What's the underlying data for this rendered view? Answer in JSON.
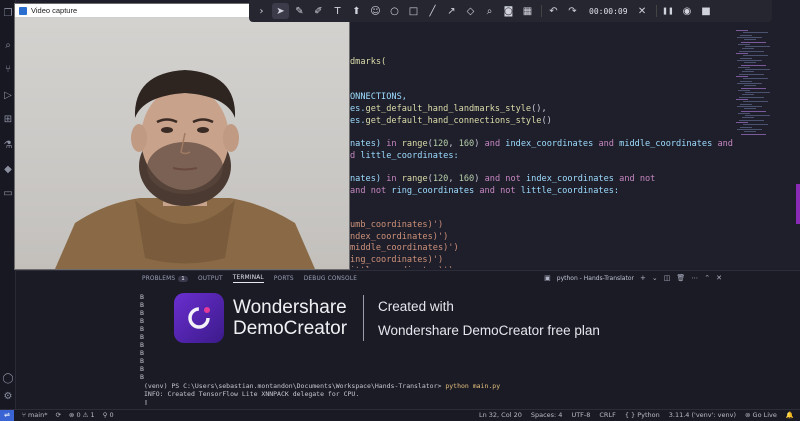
{
  "video_capture": {
    "title": "Video capture"
  },
  "recorder_toolbar": {
    "timer": "00:00:09",
    "tools": [
      "chevron-right-icon",
      "pointer-icon",
      "pen-icon",
      "highlighter-icon",
      "text-icon",
      "arrow-icon",
      "emoji-icon",
      "circle-icon",
      "square-icon",
      "line-icon",
      "arrow-diagonal-icon",
      "eraser-icon",
      "zoom-icon",
      "camera-icon",
      "blur-icon",
      "undo-icon",
      "redo-icon",
      "close-icon",
      "pause-icon",
      "record-icon",
      "stop-icon"
    ]
  },
  "code": {
    "lines": [
      {
        "segments": [
          {
            "t": "dmarks(",
            "c": "fn"
          }
        ]
      },
      {
        "segments": [
          {
            "t": "ONNECTIONS,",
            "c": "var"
          }
        ]
      },
      {
        "segments": [
          {
            "t": "es.",
            "c": "var"
          },
          {
            "t": "get_default_hand_landmarks_style",
            "c": "fn"
          },
          {
            "t": "(),",
            "c": ""
          }
        ]
      },
      {
        "segments": [
          {
            "t": "es.",
            "c": "var"
          },
          {
            "t": "get_default_hand_connections_style",
            "c": "fn"
          },
          {
            "t": "()",
            "c": ""
          }
        ]
      },
      {
        "segments": [
          {
            "t": "nates) ",
            "c": "var"
          },
          {
            "t": "in ",
            "c": "kw"
          },
          {
            "t": "range",
            "c": "fn"
          },
          {
            "t": "(",
            "c": ""
          },
          {
            "t": "120",
            "c": "num"
          },
          {
            "t": ", ",
            "c": ""
          },
          {
            "t": "160",
            "c": "num"
          },
          {
            "t": ") ",
            "c": ""
          },
          {
            "t": "and ",
            "c": "kw"
          },
          {
            "t": "index_coordinates ",
            "c": "var"
          },
          {
            "t": "and ",
            "c": "kw"
          },
          {
            "t": "middle_coordinates ",
            "c": "var"
          },
          {
            "t": "and",
            "c": "kw"
          }
        ]
      },
      {
        "segments": [
          {
            "t": "d ",
            "c": "kw"
          },
          {
            "t": "little_coordinates:",
            "c": "var"
          }
        ]
      },
      {
        "segments": [
          {
            "t": "nates) ",
            "c": "var"
          },
          {
            "t": "in ",
            "c": "kw"
          },
          {
            "t": "range",
            "c": "fn"
          },
          {
            "t": "(",
            "c": ""
          },
          {
            "t": "120",
            "c": "num"
          },
          {
            "t": ", ",
            "c": ""
          },
          {
            "t": "160",
            "c": "num"
          },
          {
            "t": ") ",
            "c": ""
          },
          {
            "t": "and not ",
            "c": "kw"
          },
          {
            "t": "index_coordinates ",
            "c": "var"
          },
          {
            "t": "and not",
            "c": "kw"
          }
        ]
      },
      {
        "segments": [
          {
            "t": "and not ",
            "c": "kw"
          },
          {
            "t": "ring_coordinates ",
            "c": "var"
          },
          {
            "t": "and not ",
            "c": "kw"
          },
          {
            "t": "little_coordinates:",
            "c": "var"
          }
        ]
      },
      {
        "segments": [
          {
            "t": "umb_coordinates)')",
            "c": "str"
          }
        ]
      },
      {
        "segments": [
          {
            "t": "ndex_coordinates)')",
            "c": "str"
          }
        ]
      },
      {
        "segments": [
          {
            "t": "middle_coordinates)')",
            "c": "str"
          }
        ]
      },
      {
        "segments": [
          {
            "t": "ing_coordinates)')",
            "c": "str"
          }
        ]
      },
      {
        "segments": [
          {
            "t": "ittle_coordinates)')",
            "c": "str"
          }
        ]
      }
    ]
  },
  "panel": {
    "tabs": [
      {
        "label": "PROBLEMS",
        "badge": "1"
      },
      {
        "label": "OUTPUT"
      },
      {
        "label": "TERMINAL",
        "active": true
      },
      {
        "label": "PORTS"
      },
      {
        "label": "DEBUG CONSOLE"
      }
    ],
    "terminal_selector": "python - Hands-Translator",
    "terminal_lines": [
      "B",
      "B",
      "B",
      "B",
      "B",
      "B",
      "B",
      "B",
      "B",
      "B",
      "B"
    ],
    "prompt": "(venv) PS C:\\Users\\sebastian.montandon\\Documents\\Workspace\\Hands-Translator> ",
    "command": "python main.py",
    "info": "INFO: Created TensorFlow Lite XNNPACK delegate for CPU."
  },
  "watermark": {
    "brand_line1": "Wondershare",
    "brand_line2": "DemoCreator",
    "text_line1": "Created with",
    "text_line2": "Wondershare DemoCreator free plan"
  },
  "status_bar": {
    "branch": "main*",
    "errors": "0",
    "warnings": "1",
    "ports": "0",
    "cursor": "Ln 32, Col 20",
    "spaces": "Spaces: 4",
    "encoding": "UTF-8",
    "eol": "CRLF",
    "language": "Python",
    "interpreter": "3.11.4 ('venv': venv)",
    "go_live": "Go Live"
  },
  "colors": {
    "accent": "#3a64d4",
    "watermark_logo": "#6a2fd0"
  }
}
